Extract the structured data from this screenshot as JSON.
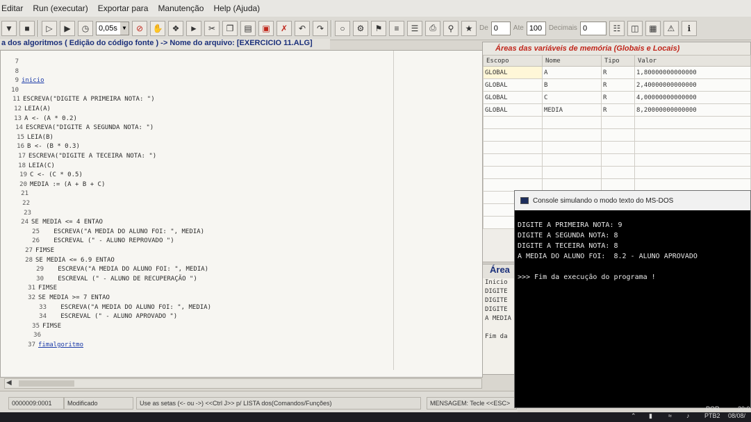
{
  "menu": [
    "Editar",
    "Run (executar)",
    "Exportar para",
    "Manutenção",
    "Help (Ajuda)"
  ],
  "toolbar": {
    "speed_value": "0,05s",
    "label_de": "De",
    "de_value": "0",
    "label_ate": "Ate",
    "ate_value": "100",
    "label_decimais": "Decimais",
    "decimais_value": "0"
  },
  "editor": {
    "title": "a dos algoritmos ( Edição do código fonte ) -> Nome do arquivo: [EXERCICIO 11.ALG]",
    "lines": [
      {
        "n": "7",
        "text": ""
      },
      {
        "n": "8",
        "text": ""
      },
      {
        "n": "9",
        "text": "inicio"
      },
      {
        "n": "10",
        "text": ""
      },
      {
        "n": "11",
        "text": "ESCREVA(\"DIGITE A PRIMEIRA NOTA: \")"
      },
      {
        "n": "12",
        "text": "LEIA(A)"
      },
      {
        "n": "13",
        "text": "A <- (A * 0.2)"
      },
      {
        "n": "14",
        "text": "ESCREVA(\"DIGITE A SEGUNDA NOTA: \")"
      },
      {
        "n": "15",
        "text": "LEIA(B)"
      },
      {
        "n": "16",
        "text": "B <- (B * 0.3)"
      },
      {
        "n": "17",
        "text": "ESCREVA(\"DIGITE A TECEIRA NOTA: \")"
      },
      {
        "n": "18",
        "text": "LEIA(C)"
      },
      {
        "n": "19",
        "text": "C <- (C * 0.5)"
      },
      {
        "n": "20",
        "text": "MEDIA := (A + B + C)"
      },
      {
        "n": "21",
        "text": ""
      },
      {
        "n": "22",
        "text": ""
      },
      {
        "n": "23",
        "text": ""
      },
      {
        "n": "24",
        "text": "SE MEDIA <= 4 ENTAO"
      },
      {
        "n": "25",
        "text": "   ESCREVA(\"A MEDIA DO ALUNO FOI: \", MEDIA)"
      },
      {
        "n": "26",
        "text": "   ESCREVAL (\" - ALUNO REPROVADO \")"
      },
      {
        "n": "27",
        "text": "FIMSE"
      },
      {
        "n": "28",
        "text": "SE MEDIA <= 6.9 ENTAO"
      },
      {
        "n": "29",
        "text": "   ESCREVA(\"A MEDIA DO ALUNO FOI: \", MEDIA)"
      },
      {
        "n": "30",
        "text": "   ESCREVAL (\" - ALUNO DE RECUPERAÇÃO \")"
      },
      {
        "n": "31",
        "text": "FIMSE"
      },
      {
        "n": "32",
        "text": "SE MEDIA >= 7 ENTAO"
      },
      {
        "n": "33",
        "text": "   ESCREVA(\"A MEDIA DO ALUNO FOI: \", MEDIA)"
      },
      {
        "n": "34",
        "text": "   ESCREVAL (\" - ALUNO APROVADO \")"
      },
      {
        "n": "35",
        "text": "FIMSE"
      },
      {
        "n": "36",
        "text": ""
      },
      {
        "n": "37",
        "text": "fimalgoritmo"
      }
    ]
  },
  "status": {
    "position": "0000009:0001",
    "state": "Modificado",
    "hint": "Use as setas (<- ou ->) <<Ctrl J>> p/ LISTA dos(Comandos/Funções)",
    "message": "MENSAGEM: Tecle <<ESC>"
  },
  "variables": {
    "title": "Áreas das variáveis de memória (Globais e Locais)",
    "headers": [
      "Escopo",
      "Nome",
      "Tipo",
      "Valor"
    ],
    "rows": [
      [
        "GLOBAL",
        "A",
        "R",
        "1,80000000000000"
      ],
      [
        "GLOBAL",
        "B",
        "R",
        "2,40000000000000"
      ],
      [
        "GLOBAL",
        "C",
        "R",
        "4,00000000000000"
      ],
      [
        "GLOBAL",
        "MEDIA",
        "R",
        "8,20000000000000"
      ]
    ]
  },
  "area": {
    "title": "Área",
    "lines": [
      "Inicio",
      "DIGITE",
      "DIGITE",
      "DIGITE",
      "A MEDIA",
      "",
      "Fim da"
    ]
  },
  "console": {
    "title": "Console simulando o modo texto do MS-DOS",
    "lines": [
      "DIGITE A PRIMEIRA NOTA: 9",
      "DIGITE A SEGUNDA NOTA: 8",
      "DIGITE A TECEIRA NOTA: 8",
      "A MEDIA DO ALUNO FOI:  8.2 - ALUNO APROVADO",
      "",
      ">>> Fim da execução do programa !"
    ]
  },
  "taskbar": {
    "lang": "POR",
    "lang2": "PTB2",
    "time": "20:0",
    "date": "08/08/"
  }
}
